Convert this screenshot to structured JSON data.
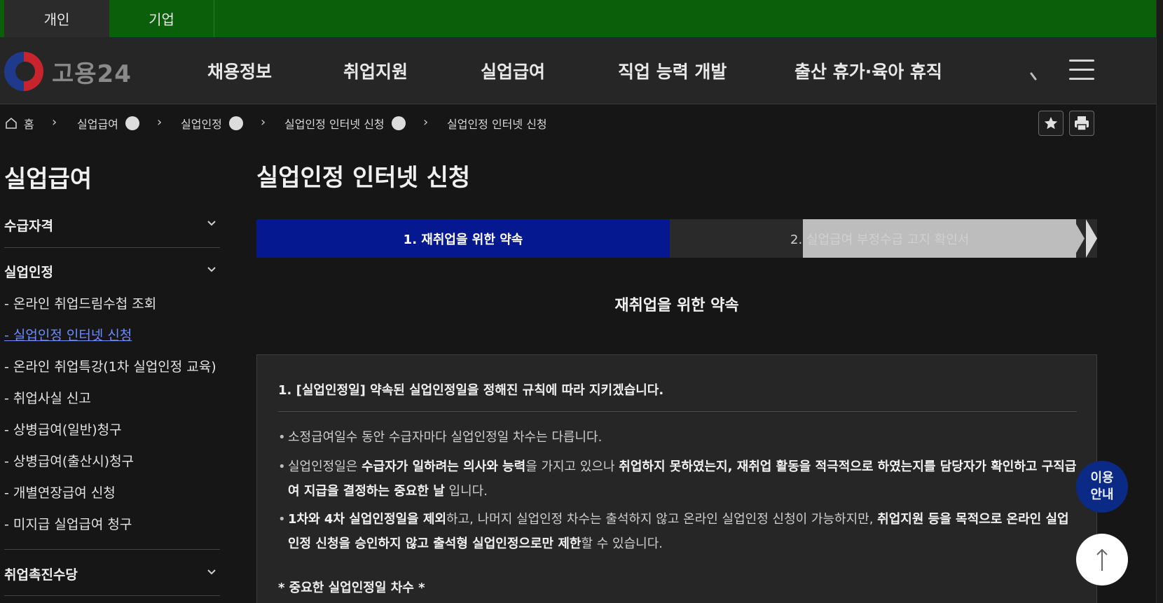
{
  "top_tabs": [
    "개인",
    "기업"
  ],
  "logo": {
    "text": "고용24"
  },
  "gnb": [
    "채용정보",
    "취업지원",
    "실업급여",
    "직업 능력 개발",
    "출산 휴가·육아 휴직"
  ],
  "header_icons": [
    "search-icon",
    "hamburger-menu-icon"
  ],
  "breadcrumb": {
    "home": "홈",
    "items": [
      "실업급여",
      "실업인정",
      "실업인정 인터넷 신청",
      "실업인정 인터넷 신청"
    ]
  },
  "tools": [
    "star-icon",
    "print-icon"
  ],
  "sidebar": {
    "title": "실업급여",
    "groups": [
      {
        "label": "수급자격"
      },
      {
        "label": "실업인정"
      },
      {
        "label": "취업촉진수당"
      }
    ],
    "sub_items": [
      "- 온라인 취업드림수첩 조회",
      "- 실업인정 인터넷 신청",
      "- 온라인 취업특강(1차 실업인정 교육)",
      "- 취업사실 신고",
      "- 상병급여(일반)청구",
      "- 상병급여(출산시)청구",
      "- 개별연장급여 신청",
      "- 미지급 실업급여 청구"
    ],
    "active_sub_index": 1
  },
  "content": {
    "title": "실업인정 인터넷 신청",
    "steps": [
      "1. 재취업을 위한 약속",
      "2. 실업급여 부정수급 고지 확인서"
    ],
    "section_heading": "재취업을 위한 약속",
    "box_heading": "1. [실업인정일] 약속된 실업인정일을 정해진 규칙에 따라 지키겠습니다.",
    "bullet1": "소정급여일수 동안 수급자마다 실업인정일 차수는 다릅니다.",
    "bullet2": {
      "p1": "실업인정일은 ",
      "b1": "수급자가 일하려는 의사와 능력",
      "p2": "을 가지고 있으나 ",
      "b2": "취업하지 못하였는지, 재취업 활동을 적극적으로 하였는지를 담당자가 확인하고 구직급여 지급을 결정하는 중요한 날",
      "p3": " 입니다."
    },
    "bullet3": {
      "b1": "1차와 4차 실업인정일을 제외",
      "p1": "하고, 나머지 실업인정 차수는 출석하지 않고 온라인 실업인정 신청이 가능하지만, ",
      "b2": "취업지원 등을 목적으로 온라인 실업인정 신청을 승인하지 않고 출석형 실업인정으로만 제한",
      "p2": "할 수 있습니다."
    },
    "important": "* 중요한 실업인정일 차수 *"
  },
  "floating": {
    "guide": "이용 안내",
    "top_icon": "arrow-up-icon"
  },
  "colors": {
    "topbar": "#0b5f0b",
    "step_active": "#06188f",
    "link_active": "#6c8cff",
    "guide_button": "#0a2a86"
  }
}
